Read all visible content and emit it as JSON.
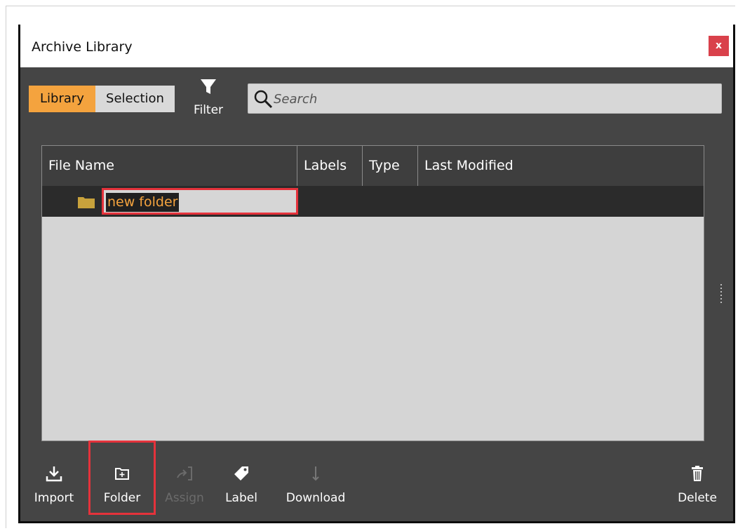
{
  "window": {
    "title": "Archive Library",
    "close_label": "x"
  },
  "tabs": [
    {
      "label": "Library",
      "active": true
    },
    {
      "label": "Selection",
      "active": false
    }
  ],
  "filter": {
    "label": "Filter",
    "icon": "funnel-icon"
  },
  "search": {
    "placeholder": "Search",
    "value": "",
    "icon": "magnifier-icon"
  },
  "table": {
    "columns": [
      "File Name",
      "Labels",
      "Type",
      "Last Modified"
    ],
    "rows": [
      {
        "name": "new folder",
        "icon": "folder-icon",
        "editing": true,
        "labels": "",
        "type": "",
        "last_modified": ""
      }
    ]
  },
  "toolbar": {
    "import": {
      "label": "Import",
      "icon": "download-tray-icon",
      "enabled": true
    },
    "folder": {
      "label": "Folder",
      "icon": "new-folder-icon",
      "enabled": true,
      "highlighted": true
    },
    "assign": {
      "label": "Assign",
      "icon": "assign-arrow-icon",
      "enabled": false
    },
    "label": {
      "label": "Label",
      "icon": "tag-icon",
      "enabled": true
    },
    "download": {
      "label": "Download",
      "icon": "down-arrow-icon",
      "enabled": false
    },
    "delete": {
      "label": "Delete",
      "icon": "trash-icon",
      "enabled": true
    }
  },
  "colors": {
    "accent": "#f4a33e",
    "highlight_border": "#e5323b",
    "panel_bg": "#454545",
    "close_button": "#d9414b"
  }
}
